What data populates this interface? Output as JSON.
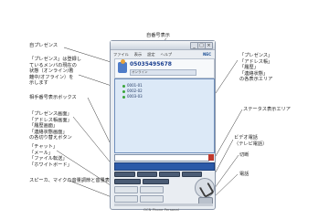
{
  "annotations": {
    "self_number": "自番号表示",
    "self_presence": "自プレゼンス",
    "presence_desc": [
      "「プレゼンス」は登録し",
      "ているメンバの現在の",
      "状態（オンライン/着",
      "離中/オフライン）を",
      "示します"
    ],
    "search_box": "相手番号表示ボックス",
    "tab_buttons": [
      "「プレゼンス画面」",
      "「アドレス帳画面」",
      "「履歴画面」",
      "「連絡状態画面」",
      "の各切り替えボタン"
    ],
    "func_buttons": [
      "「チャット」",
      "「メール」",
      "「ファイル転送」",
      "「ホワイトボード」"
    ],
    "speaker": "スピーカ、マイクの音量調節と音量表示",
    "right_display": [
      "「プレゼンス」",
      "「アドレス帳」",
      "「履歴」",
      "「連絡状態」",
      "の各表示エリア"
    ],
    "status_area": "ステータス表示エリア",
    "video_call": [
      "ビデオ電話",
      "（テレビ電話）"
    ],
    "hangup": "切断",
    "phone": "電話"
  },
  "window": {
    "menu": [
      "ファイル",
      "表示",
      "設定",
      "ヘルプ"
    ],
    "brand": "NEC",
    "self_number": "05035495678",
    "self_status": "オンライン",
    "contacts": [
      "0001-01",
      "0002-02",
      "0003-03"
    ],
    "bottom_label": "OCN Phone Personal"
  }
}
